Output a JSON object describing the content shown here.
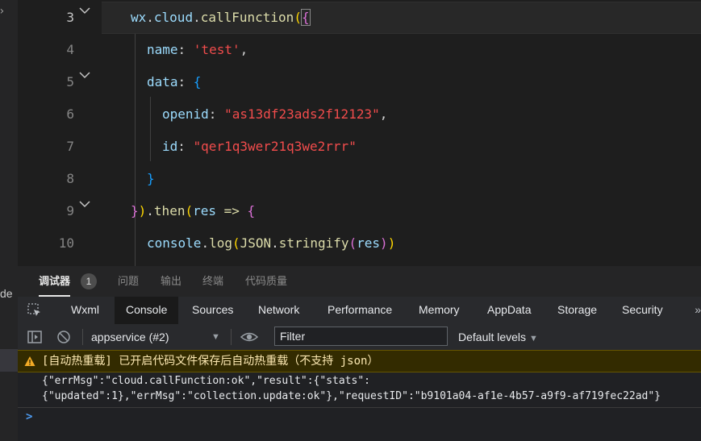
{
  "sidebar": {
    "fragment_text": "de"
  },
  "editor": {
    "lines": [
      {
        "num": "3"
      },
      {
        "num": "4"
      },
      {
        "num": "5"
      },
      {
        "num": "6"
      },
      {
        "num": "7"
      },
      {
        "num": "8"
      },
      {
        "num": "9"
      },
      {
        "num": "10"
      }
    ],
    "tokens": {
      "l3_wx": "wx",
      "l3_dot1": ".",
      "l3_cloud": "cloud",
      "l3_dot2": ".",
      "l3_fn": "callFunction",
      "l3_paren": "(",
      "l3_brace": "{",
      "l4_key": "name",
      "l4_colon": ": ",
      "l4_val": "'test'",
      "l4_comma": ",",
      "l5_key": "data",
      "l5_colon": ": ",
      "l5_brace": "{",
      "l6_key": "openid",
      "l6_colon": ": ",
      "l6_val": "\"as13df23ads2f12123\"",
      "l6_comma": ",",
      "l7_key": "id",
      "l7_colon": ": ",
      "l7_val": "\"qer1q3wer21q3we2rrr\"",
      "l8_brace": "}",
      "l9_brace": "}",
      "l9_paren": ")",
      "l9_dot": ".",
      "l9_fn": "then",
      "l9_paren2": "(",
      "l9_res": "res",
      "l9_arrow": " => ",
      "l9_brace2": "{",
      "l10_console": "console",
      "l10_dot": ".",
      "l10_log": "log",
      "l10_p1": "(",
      "l10_json": "JSON",
      "l10_dot2": ".",
      "l10_stringify": "stringify",
      "l10_p2": "(",
      "l10_res": "res",
      "l10_p3": ")",
      "l10_p4": ")"
    }
  },
  "panel_tabs": {
    "debugger": "调试器",
    "debugger_badge": "1",
    "problems": "问题",
    "output": "输出",
    "terminal": "终端",
    "quality": "代码质量"
  },
  "devtools_tabs": [
    "Wxml",
    "Console",
    "Sources",
    "Network",
    "Performance",
    "Memory",
    "AppData",
    "Storage",
    "Security"
  ],
  "devtools_active": "Console",
  "devtools_more": "»",
  "toolbar": {
    "context": "appservice (#2)",
    "filter_placeholder": "Filter",
    "levels": "Default levels"
  },
  "console": {
    "warning": "[自动热重载] 已开启代码文件保存后自动热重载（不支持 json）",
    "log_line1": "{\"errMsg\":\"cloud.callFunction:ok\",\"result\":{\"stats\":",
    "log_line2": "{\"updated\":1},\"errMsg\":\"collection.update:ok\"},\"requestID\":\"b9101a04-af1e-4b57-a9f9-af719fec22ad\"}",
    "prompt": ">"
  },
  "colors": {
    "editor_bg": "#1e1e1e",
    "string": "#ce9178",
    "function": "#dcdcaa",
    "variable": "#9cdcfe",
    "warning_bg": "#332b00",
    "warning_text": "#fce8b2",
    "prompt": "#4d9bf0"
  }
}
